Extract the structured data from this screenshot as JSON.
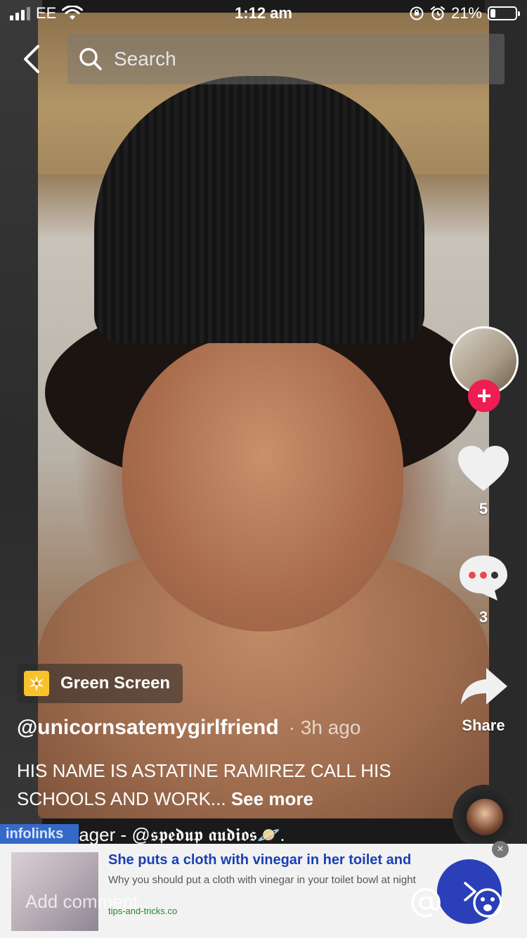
{
  "status_bar": {
    "carrier": "EE",
    "time": "1:12 am",
    "battery_percent": "21%",
    "battery_level": 0.21
  },
  "search": {
    "placeholder": "Search"
  },
  "actions": {
    "like_count": "5",
    "comment_count": "3",
    "share_label": "Share"
  },
  "effect_tag": {
    "label": "Green Screen"
  },
  "post": {
    "username": "@unicornsatemygirlfriend",
    "time_ago": "· 3h ago",
    "caption": "HIS NAME IS ASTATINE RAMIREZ CALL HIS SCHOOLS AND WORK...",
    "see_more": "See more"
  },
  "music": {
    "title": "mr rager - @𝖘𝖕𝖊𝖉𝖚𝖕 𝖆𝖚𝖉𝖎𝖔𝖘🪐."
  },
  "ad": {
    "badge": "infolinks",
    "title": "She puts a cloth with vinegar in her toilet and",
    "description": "Why you should put a cloth with vinegar in your toilet bowl at night",
    "domain": "tips-and-tricks.co"
  },
  "comment": {
    "placeholder": "Add comment..."
  },
  "colors": {
    "follow_accent": "#ee1d52",
    "green_screen_icon": "#f7c22b",
    "ad_title": "#1a3fb3",
    "ad_cta": "#2a3fb8"
  }
}
